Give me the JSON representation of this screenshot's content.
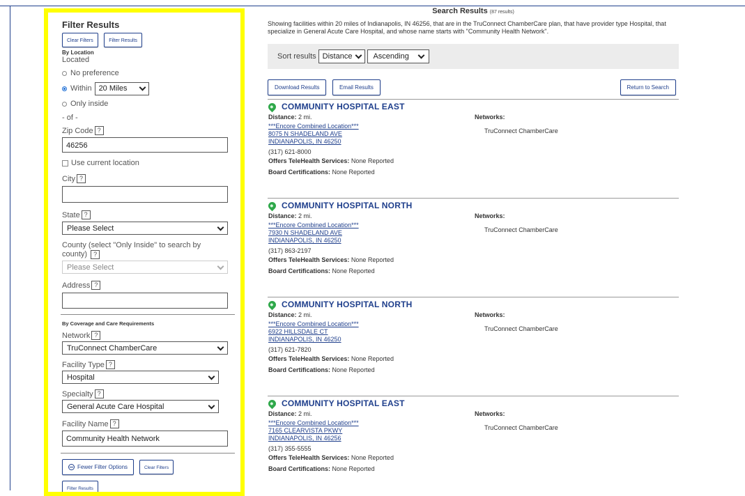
{
  "sidebar": {
    "title": "Filter Results",
    "clear_filters": "Clear Filters",
    "filter_results": "Filter Results",
    "by_location": "By Location",
    "located_label": "Located",
    "no_preference": "No preference",
    "within": "Within",
    "within_value": "20 Miles",
    "only_inside": "Only inside",
    "of": "- of -",
    "zip_label": "Zip Code",
    "zip_value": "46256",
    "use_current_location": "Use current location",
    "city_label": "City",
    "state_label": "State",
    "state_value": "Please Select",
    "county_label": "County (select \"Only Inside\" to search by county)",
    "county_value": "Please Select",
    "address_label": "Address",
    "coverage_section": "By Coverage and Care Requirements",
    "network_label": "Network",
    "network_value": "TruConnect ChamberCare",
    "facility_type_label": "Facility Type",
    "facility_type_value": "Hospital",
    "specialty_label": "Specialty",
    "specialty_value": "General Acute Care Hospital",
    "facility_name_label": "Facility Name",
    "facility_name_value": "Community Health Network",
    "fewer_filter_options": "Fewer Filter Options",
    "clear_filters_bottom": "Clear Filters",
    "filter_results_bottom": "Filter Results",
    "help": "?"
  },
  "results": {
    "title": "Search Results",
    "count": "(87 results)",
    "summary": "Showing facilities within 20 miles of Indianapolis, IN 46256, that are in the TruConnect ChamberCare plan, that have provider type Hospital, that specialize in General Acute Care Hospital, and whose name starts with \"Community Health Network\".",
    "sort_label": "Sort results",
    "sort_by": "Distance",
    "sort_order": "Ascending",
    "download": "Download Results",
    "email": "Email Results",
    "return": "Return to Search",
    "labels": {
      "distance": "Distance:",
      "networks": "Networks:",
      "telehealth": "Offers TeleHealth Services:",
      "board": "Board Certifications:"
    },
    "facilities": [
      {
        "name": "COMMUNITY HOSPITAL EAST",
        "distance": "2 mi.",
        "location": "***Encore Combined Location***",
        "street": "8075 N SHADELAND AVE",
        "city": "INDIANAPOLIS, IN 46250",
        "phone": "(317) 621-8000",
        "telehealth": "None Reported",
        "board": "None Reported",
        "network": "TruConnect ChamberCare"
      },
      {
        "name": "COMMUNITY HOSPITAL NORTH",
        "distance": "2 mi.",
        "location": "***Encore Combined Location***",
        "street": "7930 N SHADELAND AVE",
        "city": "INDIANAPOLIS, IN 46250",
        "phone": "(317) 863-2197",
        "telehealth": "None Reported",
        "board": "None Reported",
        "network": "TruConnect ChamberCare"
      },
      {
        "name": "COMMUNITY HOSPITAL NORTH",
        "distance": "2 mi.",
        "location": "***Encore Combined Location***",
        "street": "6922 HILLSDALE CT",
        "city": "INDIANAPOLIS, IN 46250",
        "phone": "(317) 621-7820",
        "telehealth": "None Reported",
        "board": "None Reported",
        "network": "TruConnect ChamberCare"
      },
      {
        "name": "COMMUNITY HOSPITAL EAST",
        "distance": "2 mi.",
        "location": "***Encore Combined Location***",
        "street": "7165 CLEARVISTA PKWY",
        "city": "INDIANAPOLIS, IN 46256",
        "phone": "(317) 355-5555",
        "telehealth": "None Reported",
        "board": "None Reported",
        "network": "TruConnect ChamberCare"
      }
    ]
  }
}
